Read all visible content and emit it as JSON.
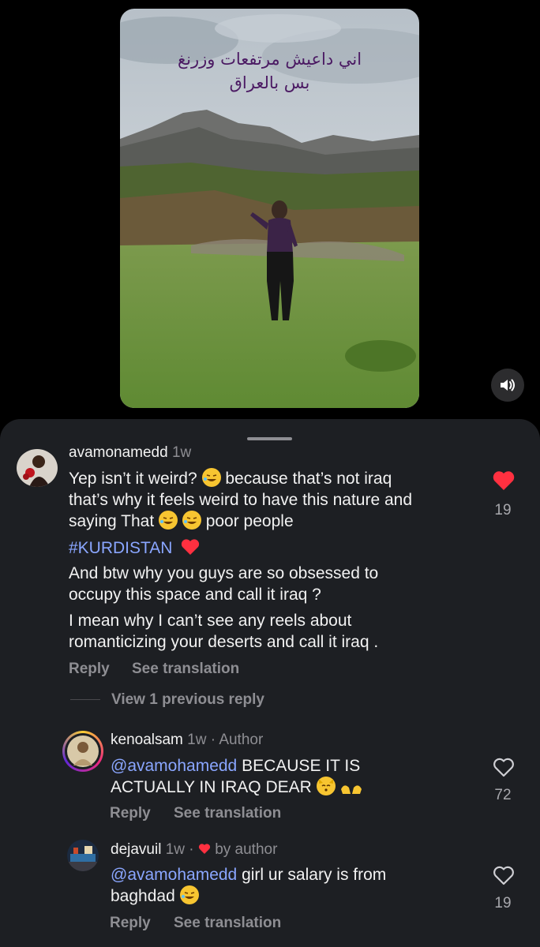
{
  "video": {
    "overlay_line1": "اني داعيش مرتفعات وزرنغ",
    "overlay_line2": "بس بالعراق",
    "mute_icon": "speaker-sound-icon"
  },
  "comments": [
    {
      "username": "avamonamedd",
      "time": "1w",
      "line1": "Yep isn’t it weird?",
      "line1b": " because that’s not iraq",
      "line2": "that’s why it feels weird to have this nature and",
      "line3a": "saying That ",
      "line3b": " poor people",
      "hashtag": "#KURDISTAN",
      "para2_line1": "And btw why you guys are so obsessed to",
      "para2_line2": "occupy this space and call it iraq ?",
      "para3_line1": "I mean why I can’t see any reels about",
      "para3_line2": "romanticizing your deserts and call it iraq .",
      "reply_label": "Reply",
      "translate_label": "See translation",
      "likes": "19",
      "liked": true,
      "view_replies": "View 1 previous reply"
    },
    {
      "username": "kenoalsam",
      "time": "1w",
      "tag": "Author",
      "mention": "@avamohamedd",
      "text1": " BECAUSE IT IS",
      "text2": "ACTUALLY IN IRAQ DEAR ",
      "reply_label": "Reply",
      "translate_label": "See translation",
      "likes": "72"
    },
    {
      "username": "dejavuil",
      "time": "1w",
      "tag": "by author",
      "mention": "@avamohamedd",
      "text1": " girl ur salary is from",
      "text2": "baghdad ",
      "reply_label": "Reply",
      "translate_label": "See translation",
      "likes": "19"
    }
  ],
  "colors": {
    "sheet_bg": "#1d1f23",
    "heart_red": "#ff3040",
    "mention_blue": "#8aa6ff"
  }
}
